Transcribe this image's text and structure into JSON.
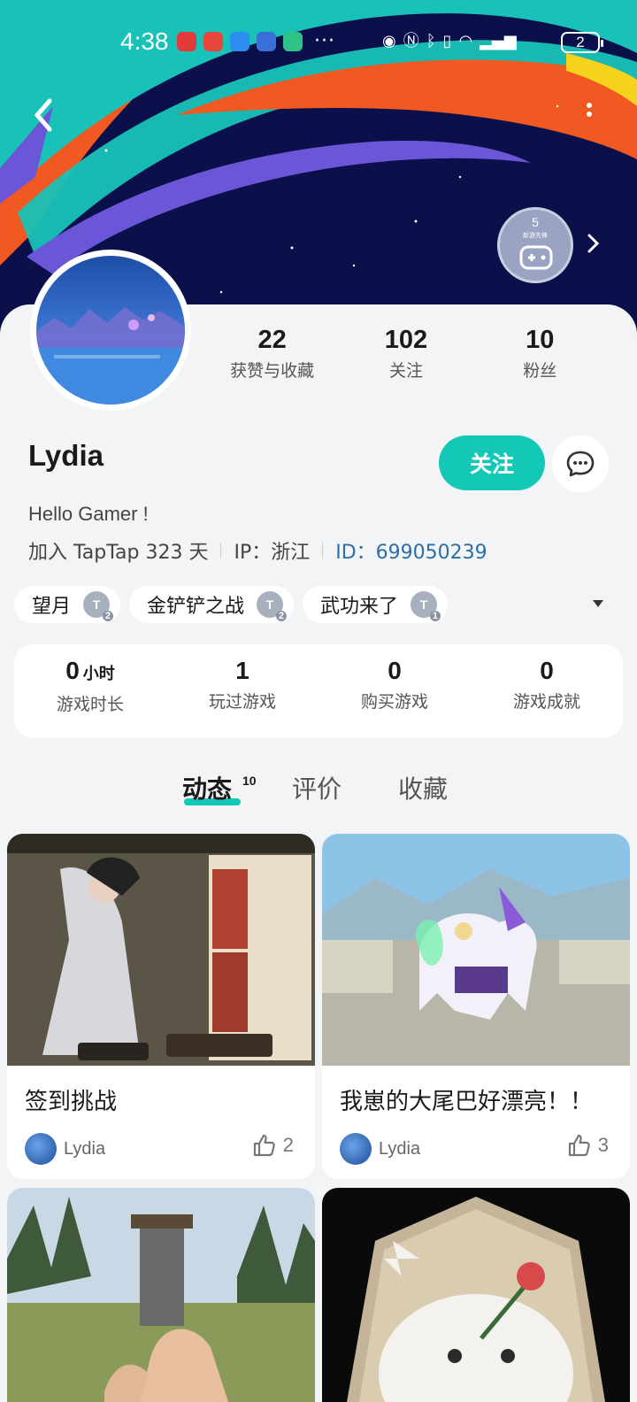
{
  "status": {
    "time": "4:38",
    "battery": "2",
    "more": "···"
  },
  "profile": {
    "name": "Lydia",
    "bio": "Hello Gamer !",
    "joined": "加入 TapTap 323 天",
    "ip": "IP：浙江",
    "id": "ID：699050239",
    "follow_label": "关注",
    "badge_num": "5",
    "badge_caption": "新游先锋"
  },
  "stats": [
    {
      "value": "22",
      "label": "获赞与收藏"
    },
    {
      "value": "102",
      "label": "关注"
    },
    {
      "value": "10",
      "label": "粉丝"
    }
  ],
  "tags": [
    {
      "name": "望月",
      "icon": "T",
      "level": "2"
    },
    {
      "name": "金铲铲之战",
      "icon": "T",
      "level": "2"
    },
    {
      "name": "武功来了",
      "icon": "T",
      "level": "1"
    }
  ],
  "game_stats": [
    {
      "value": "0",
      "unit": "小时",
      "label": "游戏时长"
    },
    {
      "value": "1",
      "unit": "",
      "label": "玩过游戏"
    },
    {
      "value": "0",
      "unit": "",
      "label": "购买游戏"
    },
    {
      "value": "0",
      "unit": "",
      "label": "游戏成就"
    }
  ],
  "tabs": [
    {
      "label": "动态",
      "count": "10"
    },
    {
      "label": "评价"
    },
    {
      "label": "收藏"
    }
  ],
  "posts": [
    {
      "title": "签到挑战",
      "author": "Lydia",
      "likes": "2"
    },
    {
      "title": "我崽的大尾巴好漂亮！！",
      "author": "Lydia",
      "likes": "3"
    }
  ],
  "colors": {
    "accent": "#14c8b8",
    "banner_bg": "#0b0f4a",
    "id_link": "#2d6ea5"
  }
}
